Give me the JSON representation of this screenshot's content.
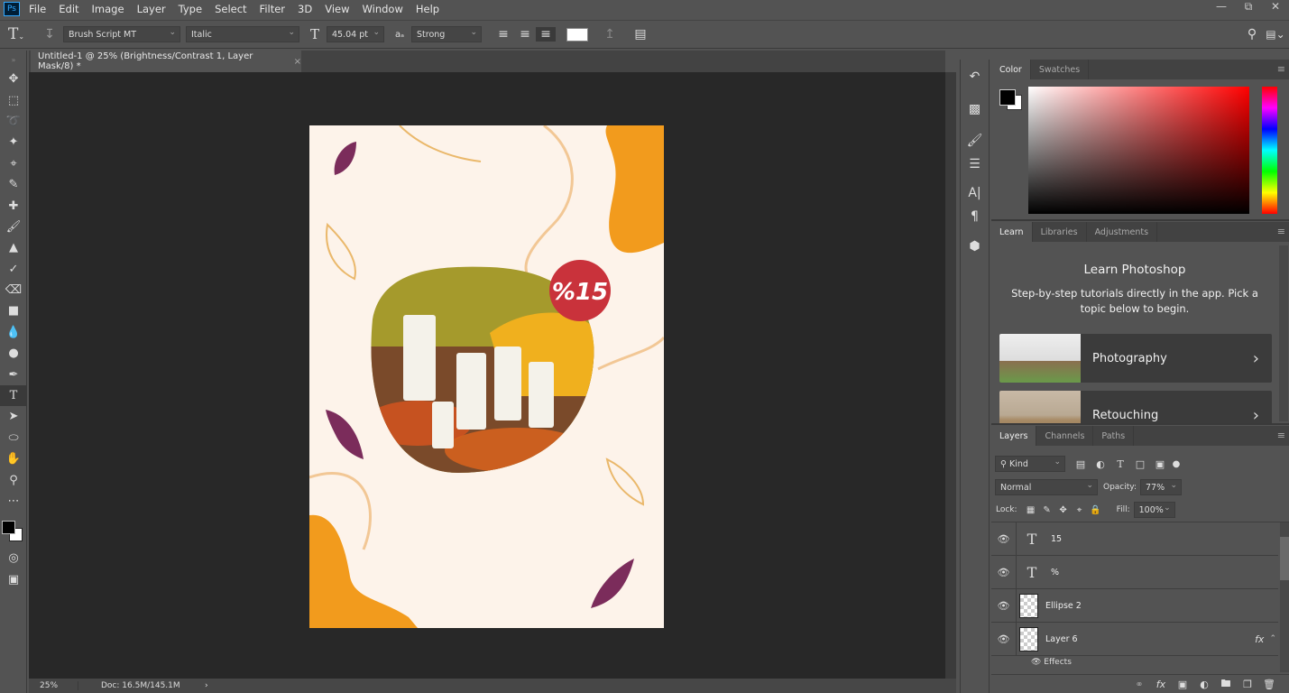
{
  "app": {
    "logo": "Ps"
  },
  "menu": [
    "File",
    "Edit",
    "Image",
    "Layer",
    "Type",
    "Select",
    "Filter",
    "3D",
    "View",
    "Window",
    "Help"
  ],
  "options": {
    "font_family": "Brush Script MT",
    "font_style": "Italic",
    "font_size": "45.04 pt",
    "antialias": "Strong",
    "aa_label": "aₐ",
    "text_color": "#ffffff"
  },
  "document": {
    "tab_title": "Untitled-1 @ 25% (Brightness/Contrast 1, Layer Mask/8) *",
    "close": "×",
    "badge_text": "%15"
  },
  "status": {
    "zoom": "25%",
    "doc": "Doc: 16.5M/145.1M",
    "arrow": "›"
  },
  "color_panel": {
    "tabs": [
      "Color",
      "Swatches"
    ],
    "foreground": "#000000",
    "background": "#ffffff",
    "hue": "#ff0000"
  },
  "learn_panel": {
    "tabs": [
      "Learn",
      "Libraries",
      "Adjustments"
    ],
    "title": "Learn Photoshop",
    "subtitle": "Step-by-step tutorials directly in the app. Pick a topic below to begin.",
    "cards": [
      {
        "label": "Photography"
      },
      {
        "label": "Retouching"
      }
    ]
  },
  "layers_panel": {
    "tabs": [
      "Layers",
      "Channels",
      "Paths"
    ],
    "filter": "Kind",
    "blend_mode": "Normal",
    "opacity_label": "Opacity:",
    "opacity": "77%",
    "lock_label": "Lock:",
    "fill_label": "Fill:",
    "fill": "100%",
    "layers": [
      {
        "name": "15",
        "type": "text"
      },
      {
        "name": "%",
        "type": "text"
      },
      {
        "name": "Ellipse 2",
        "type": "shape"
      },
      {
        "name": "Layer 6",
        "type": "pixel",
        "fx": "fx"
      }
    ],
    "effects_label": "Effects"
  },
  "colors": {
    "accent_orange": "#f29b1d",
    "leaf_purple": "#7b2c5b",
    "badge_red": "#c9323b",
    "poster_bg": "#fdf3ea"
  }
}
